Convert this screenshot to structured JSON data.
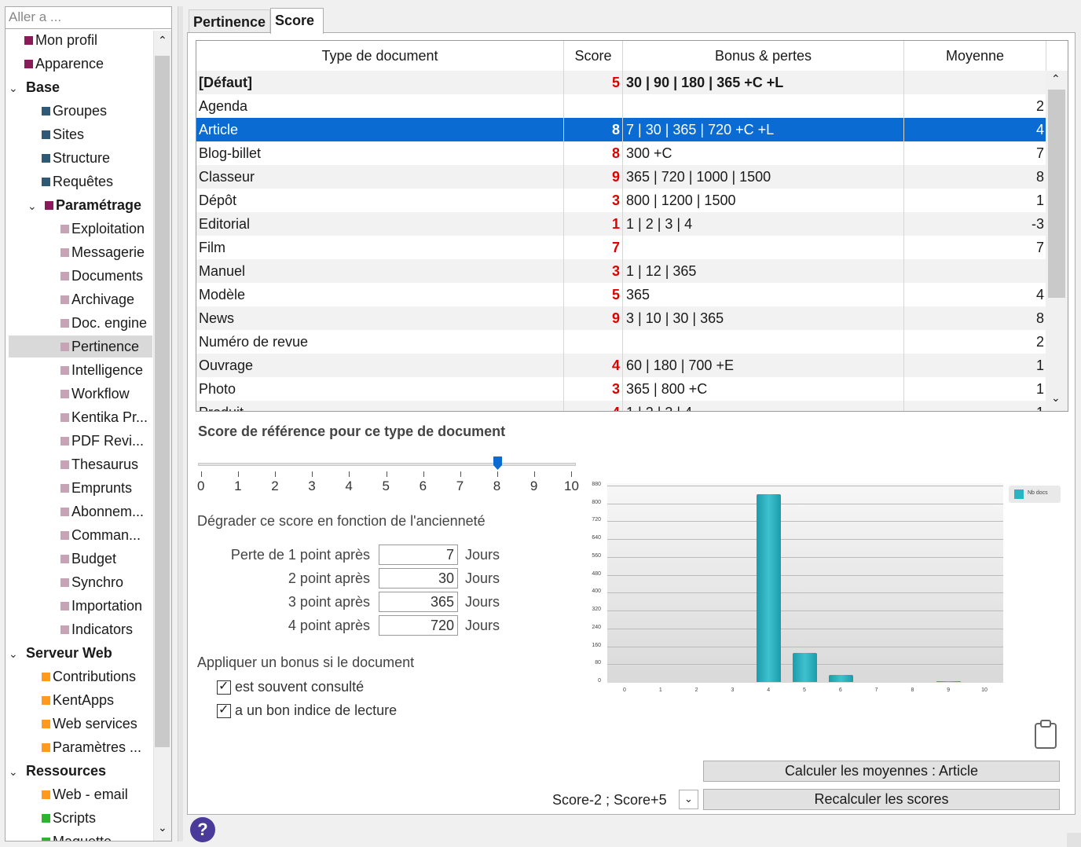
{
  "sidebar": {
    "goto_placeholder": "Aller a ...",
    "items": [
      {
        "label": "Mon profil",
        "color": "#8b1a5a"
      },
      {
        "label": "Apparence",
        "color": "#8b1a5a"
      },
      {
        "label": "Base"
      },
      {
        "label": "Groupes",
        "color": "#2e5a75"
      },
      {
        "label": "Sites",
        "color": "#2e5a75"
      },
      {
        "label": "Structure",
        "color": "#2e5a75"
      },
      {
        "label": "Requêtes",
        "color": "#2e5a75"
      },
      {
        "label": "Paramétrage",
        "color": "#8b1a5a"
      },
      {
        "label": "Exploitation",
        "color": "#c8a2b7"
      },
      {
        "label": "Messagerie",
        "color": "#c8a2b7"
      },
      {
        "label": "Documents",
        "color": "#c8a2b7"
      },
      {
        "label": "Archivage",
        "color": "#c8a2b7"
      },
      {
        "label": "Doc. engine",
        "color": "#c8a2b7"
      },
      {
        "label": "Pertinence",
        "color": "#c8a2b7"
      },
      {
        "label": "Intelligence",
        "color": "#c8a2b7"
      },
      {
        "label": "Workflow",
        "color": "#c8a2b7"
      },
      {
        "label": "Kentika Pr...",
        "color": "#c8a2b7"
      },
      {
        "label": "PDF Revi...",
        "color": "#c8a2b7"
      },
      {
        "label": "Thesaurus",
        "color": "#c8a2b7"
      },
      {
        "label": "Emprunts",
        "color": "#c8a2b7"
      },
      {
        "label": "Abonnem...",
        "color": "#c8a2b7"
      },
      {
        "label": "Comman...",
        "color": "#c8a2b7"
      },
      {
        "label": "Budget",
        "color": "#c8a2b7"
      },
      {
        "label": "Synchro",
        "color": "#c8a2b7"
      },
      {
        "label": "Importation",
        "color": "#c8a2b7"
      },
      {
        "label": "Indicators",
        "color": "#c8a2b7"
      },
      {
        "label": "Serveur Web"
      },
      {
        "label": "Contributions",
        "color": "#ff9a1f"
      },
      {
        "label": "KentApps",
        "color": "#ff9a1f"
      },
      {
        "label": "Web services",
        "color": "#ff9a1f"
      },
      {
        "label": "Paramètres ...",
        "color": "#ff9a1f"
      },
      {
        "label": "Ressources"
      },
      {
        "label": "Web - email",
        "color": "#ff9a1f"
      },
      {
        "label": "Scripts",
        "color": "#2db52d"
      },
      {
        "label": "Maquette",
        "color": "#2db52d"
      }
    ]
  },
  "tabs": {
    "pertinence": "Pertinence",
    "score": "Score"
  },
  "table": {
    "headers": [
      "Type de document",
      "Score",
      "Bonus & pertes",
      "Moyenne"
    ],
    "rows": [
      {
        "type": "[Défaut]",
        "score": "5",
        "bonus": "30 | 90 | 180 | 365 +C +L",
        "moyenne": ""
      },
      {
        "type": "Agenda",
        "score": "",
        "bonus": "",
        "moyenne": "2"
      },
      {
        "type": "Article",
        "score": "8",
        "bonus": "7 | 30 | 365 | 720 +C +L",
        "moyenne": "4"
      },
      {
        "type": "Blog-billet",
        "score": "8",
        "bonus": "300 +C",
        "moyenne": "7"
      },
      {
        "type": "Classeur",
        "score": "9",
        "bonus": "365 | 720 | 1000 | 1500",
        "moyenne": "8"
      },
      {
        "type": "Dépôt",
        "score": "3",
        "bonus": "800 | 1200 | 1500",
        "moyenne": "1"
      },
      {
        "type": "Editorial",
        "score": "1",
        "bonus": "1 | 2 | 3 | 4",
        "moyenne": "-3"
      },
      {
        "type": "Film",
        "score": "7",
        "bonus": "",
        "moyenne": "7"
      },
      {
        "type": "Manuel",
        "score": "3",
        "bonus": "1 | 12 | 365",
        "moyenne": ""
      },
      {
        "type": "Modèle",
        "score": "5",
        "bonus": "365",
        "moyenne": "4"
      },
      {
        "type": "News",
        "score": "9",
        "bonus": "3 | 10 | 30 | 365",
        "moyenne": "8"
      },
      {
        "type": "Numéro de revue",
        "score": "",
        "bonus": "",
        "moyenne": "2"
      },
      {
        "type": "Ouvrage",
        "score": "4",
        "bonus": "60 | 180 | 700 +E",
        "moyenne": "1"
      },
      {
        "type": "Photo",
        "score": "3",
        "bonus": "365 | 800 +C",
        "moyenne": "1"
      },
      {
        "type": "Produit",
        "score": "4",
        "bonus": "1 | 2 | 3 | 4",
        "moyenne": "1"
      }
    ]
  },
  "reference": {
    "title": "Score de référence pour ce type de document",
    "slider_value": 8,
    "slider_ticks": [
      "0",
      "1",
      "2",
      "3",
      "4",
      "5",
      "6",
      "7",
      "8",
      "9",
      "10"
    ]
  },
  "degrade": {
    "title": "Dégrader ce score en fonction de l'ancienneté",
    "rows": [
      {
        "label": "Perte de 1 point après",
        "value": "7",
        "unit": "Jours"
      },
      {
        "label": "2 point après",
        "value": "30",
        "unit": "Jours"
      },
      {
        "label": "3 point après",
        "value": "365",
        "unit": "Jours"
      },
      {
        "label": "4 point après",
        "value": "720",
        "unit": "Jours"
      }
    ]
  },
  "bonus": {
    "title": "Appliquer un bonus si le document",
    "options": [
      {
        "label": "est souvent consulté",
        "checked": true
      },
      {
        "label": "a un bon indice de lecture",
        "checked": true
      }
    ]
  },
  "chart_data": {
    "type": "bar",
    "categories": [
      "0",
      "1",
      "2",
      "3",
      "4",
      "5",
      "6",
      "7",
      "8",
      "9",
      "10"
    ],
    "series": [
      {
        "name": "Nb docs",
        "values": [
          0,
          0,
          0,
          0,
          840,
          130,
          30,
          0,
          0,
          5,
          0
        ]
      }
    ],
    "ylim": [
      0,
      880
    ],
    "yticks": [
      "0",
      "80",
      "160",
      "240",
      "320",
      "400",
      "480",
      "560",
      "640",
      "720",
      "800",
      "880"
    ],
    "legend": "top-right",
    "color": "#2ab3c0"
  },
  "buttons": {
    "calc": "Calculer les moyennes : Article",
    "recalc": "Recalculer les scores",
    "score_select": "Score-2 ; Score+5"
  },
  "help": "?"
}
